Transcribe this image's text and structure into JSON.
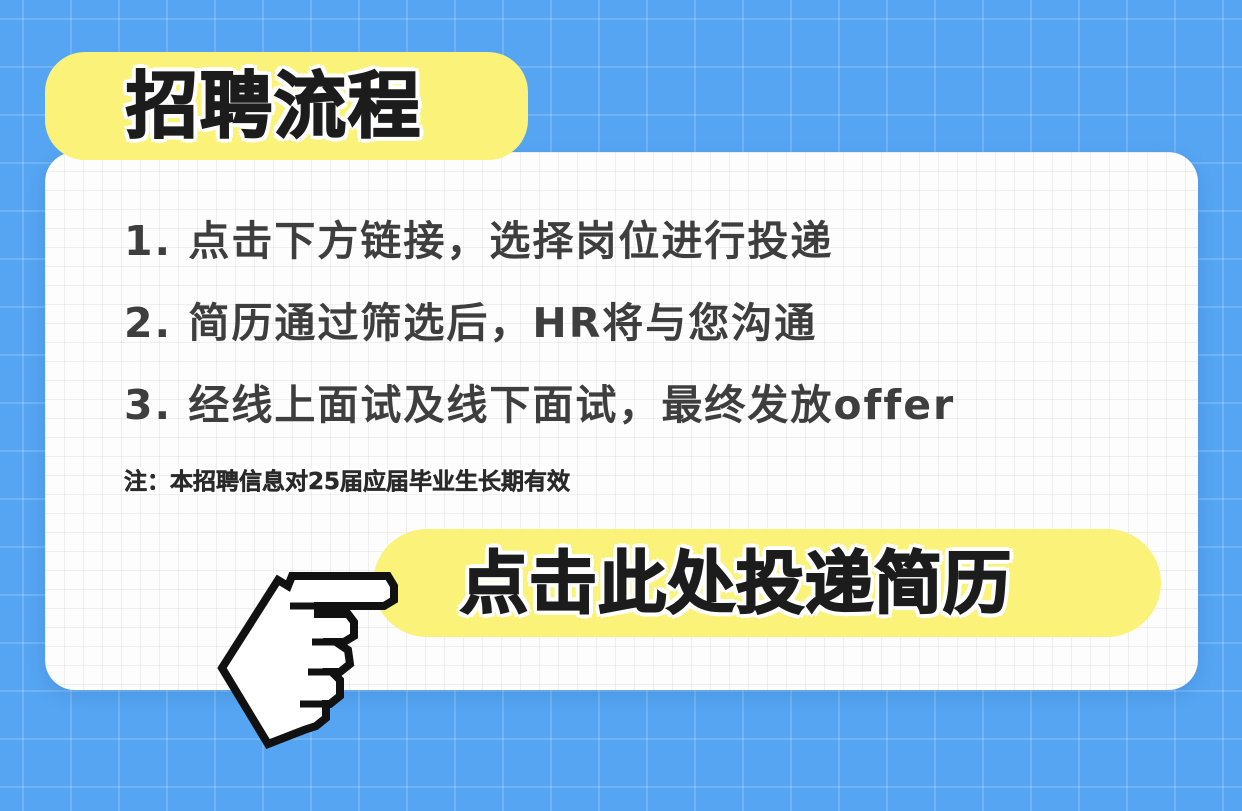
{
  "title": "招聘流程",
  "steps": [
    "1. 点击下方链接，选择岗位进行投递",
    "2. 简历通过筛选后，HR将与您沟通",
    "3. 经线上面试及线下面试，最终发放offer"
  ],
  "note": "注：本招聘信息对25届应届毕业生长期有效",
  "cta": {
    "label": "点击此处投递简历",
    "icon": "pointing-hand-cursor-icon"
  },
  "colors": {
    "background": "#56a5f2",
    "card": "#fdfdfd",
    "highlight": "#fbf27a",
    "text": "#3e3e3e"
  }
}
